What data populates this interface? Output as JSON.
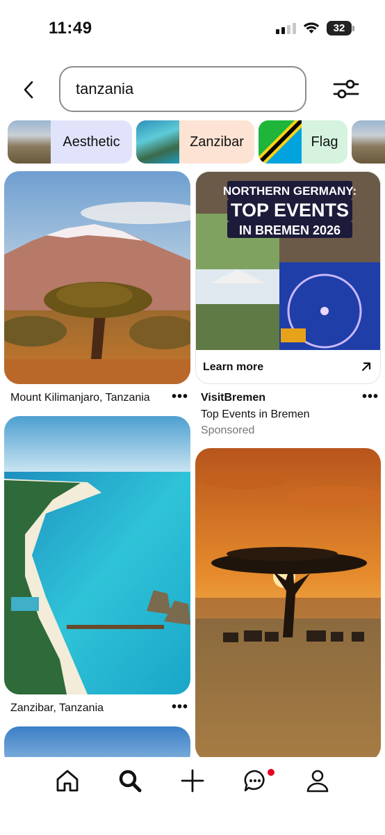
{
  "status_bar": {
    "time": "11:49",
    "battery": "32"
  },
  "search": {
    "query": "tanzania"
  },
  "chips": [
    {
      "label": "Aesthetic",
      "bg": "#e1e3fb"
    },
    {
      "label": "Zanzibar",
      "bg": "#fde3d3"
    },
    {
      "label": "Flag",
      "bg": "#d5f3de"
    }
  ],
  "pins": [
    {
      "caption": "Mount Kilimanjaro, Tanzania"
    },
    {
      "caption": "Zanzibar, Tanzania"
    }
  ],
  "ad": {
    "headline_line1": "NORTHERN GERMANY:",
    "headline_line2": "TOP EVENTS",
    "headline_line3": "IN BREMEN 2026",
    "cta": "Learn more",
    "advertiser": "VisitBremen",
    "title": "Top Events in Bremen",
    "label": "Sponsored"
  },
  "more_label": "•••",
  "nav": [
    "home-icon",
    "search-icon",
    "create-icon",
    "messages-icon",
    "profile-icon"
  ],
  "colors": {
    "accent": "#e60023",
    "text": "#111111"
  }
}
